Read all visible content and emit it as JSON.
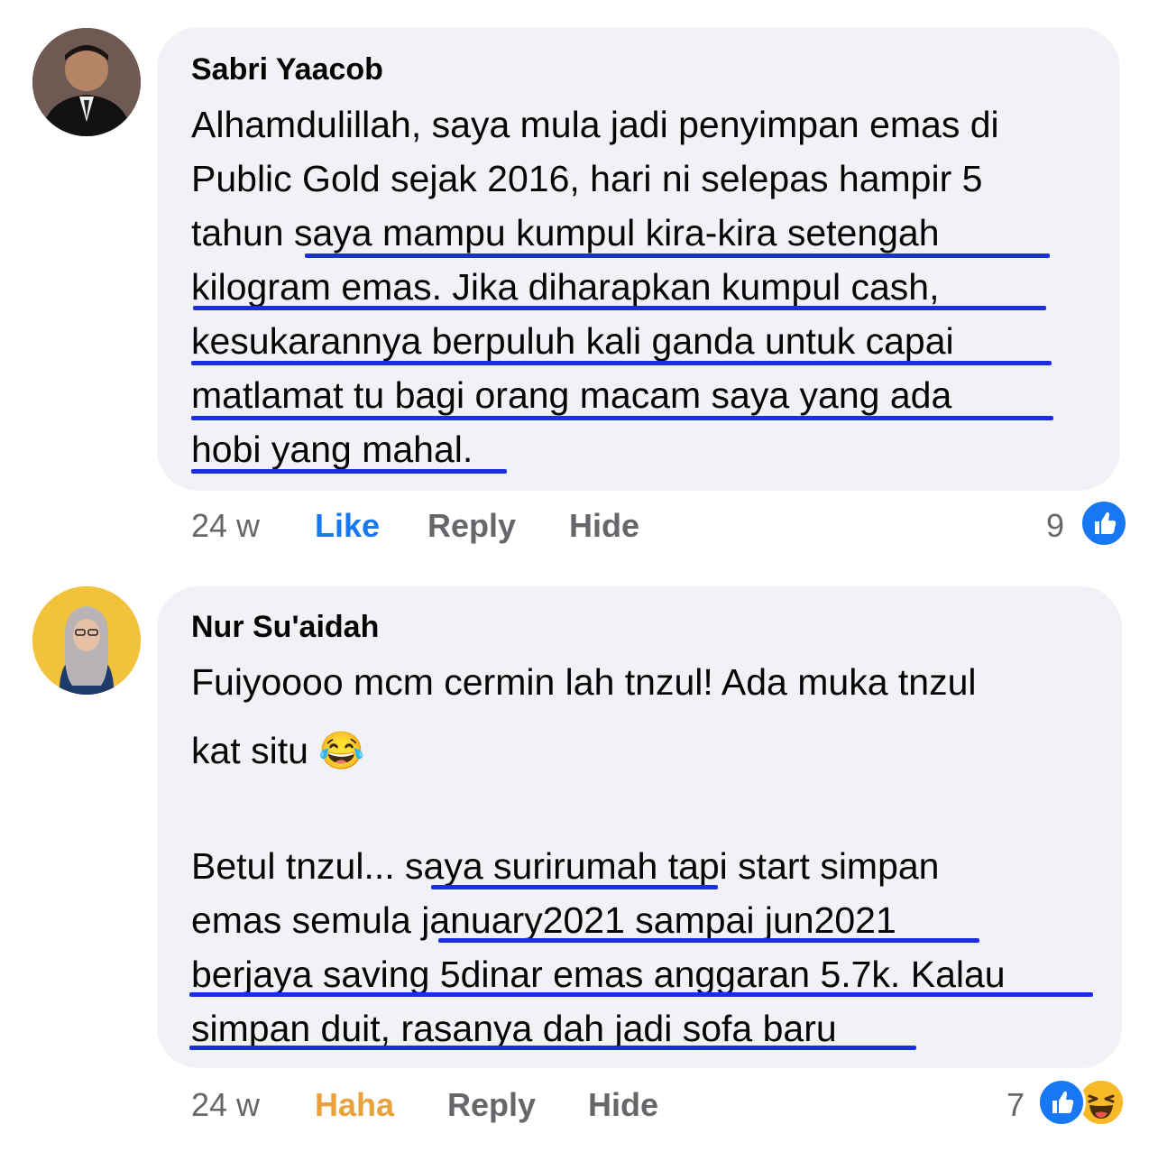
{
  "comments": [
    {
      "author": "Sabri Yaacob",
      "lines": [
        "Alhamdulillah, saya mula jadi penyimpan emas di",
        "Public Gold sejak 2016, hari ni selepas hampir 5",
        "tahun ",
        "saya mampu kumpul kira-kira setengah",
        "kilogram emas. Jika diharapkan kumpul cash,",
        "kesukarannya berpuluh kali ganda untuk capai",
        "matlamat tu bagi orang macam saya yang ada",
        "hobi yang mahal."
      ],
      "time": "24 w",
      "reaction_label": "Like",
      "reply_label": "Reply",
      "hide_label": "Hide",
      "reaction_count": "9",
      "reaction_icons": [
        "like-icon"
      ]
    },
    {
      "author": "Nur Su'aidah",
      "lines": [
        "Fuiyoooo mcm cermin lah tnzul! Ada muka tnzul",
        "kat situ 😂",
        "Betul tnzul... ",
        "saya surirumah",
        " tapi start simpan",
        "emas semula ",
        "january2021 sampai jun2021",
        "berjaya saving 5dinar emas anggaran 5.7k. Kalau",
        "simpan duit, rasanya dah jadi sofa baru"
      ],
      "time": "24 w",
      "reaction_label": "Haha",
      "reply_label": "Reply",
      "hide_label": "Hide",
      "reaction_count": "7",
      "reaction_icons": [
        "like-icon",
        "haha-icon"
      ]
    }
  ],
  "colors": {
    "underline": "#1c2fe0",
    "like_blue": "#1877f2",
    "haha_orange": "#e9a23b",
    "bubble_bg": "#f0f2f5",
    "meta_gray": "#65676b"
  }
}
